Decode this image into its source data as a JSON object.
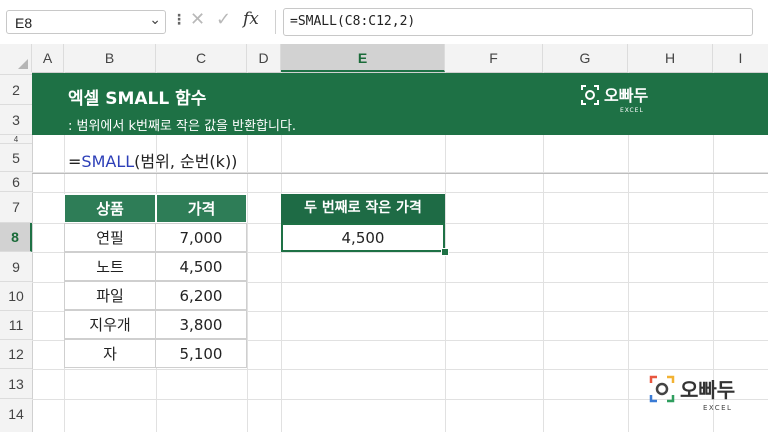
{
  "formula_bar": {
    "name_box": "E8",
    "name_box_arrow": "⌄",
    "dots": "⋮",
    "cancel": "✕",
    "enter": "✓",
    "fx": "fx",
    "formula": "=SMALL(C8:C12,2)"
  },
  "columns": [
    "A",
    "B",
    "C",
    "D",
    "E",
    "F",
    "G",
    "H",
    "I"
  ],
  "rows": [
    "2",
    "3",
    "4",
    "5",
    "6",
    "7",
    "8",
    "9",
    "10",
    "11",
    "12",
    "13",
    "14"
  ],
  "selected_cell": {
    "column": "E",
    "row": "8"
  },
  "banner": {
    "title": "엑셀 SMALL 함수",
    "subtitle": ": 범위에서 k번째로 작은 값을 반환합니다."
  },
  "logo": {
    "name": "오빠두",
    "sub": "EXCEL"
  },
  "syntax": {
    "prefix": "=",
    "function": "SMALL",
    "args": "(범위, 순번(k))"
  },
  "table": {
    "headers": [
      "상품",
      "가격"
    ],
    "rows": [
      [
        "연필",
        "7,000"
      ],
      [
        "노트",
        "4,500"
      ],
      [
        "파일",
        "6,200"
      ],
      [
        "지우개",
        "3,800"
      ],
      [
        "자",
        "5,100"
      ]
    ]
  },
  "result": {
    "header": "두 번째로 작은 가격",
    "value": "4,500"
  },
  "colors": {
    "banner": "#1e7145",
    "table_header": "#2e7d57",
    "function_text": "#2d3fb8",
    "selection": "#1e7145"
  }
}
